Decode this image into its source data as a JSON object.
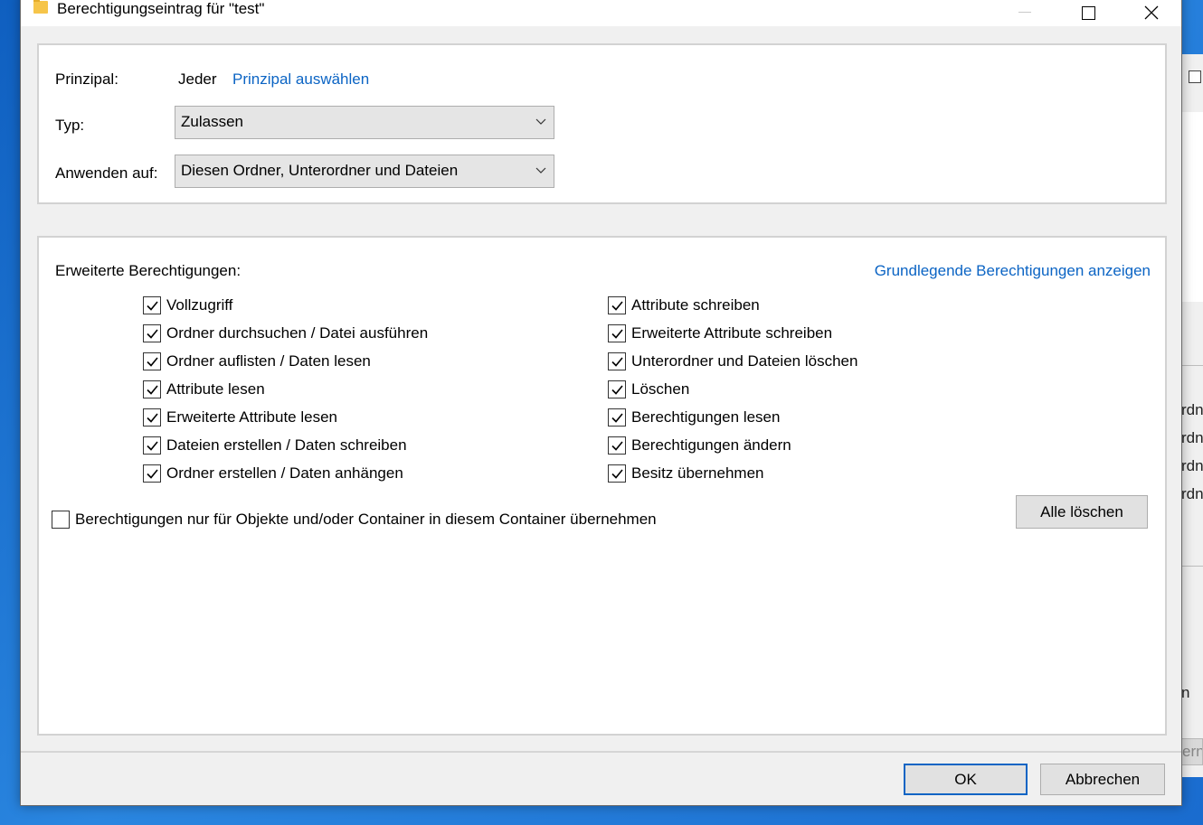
{
  "window": {
    "title": "Berechtigungseintrag für \"test\"",
    "accent_color": "#0b64c4"
  },
  "principal": {
    "label": "Prinzipal:",
    "value": "Jeder",
    "select_link": "Prinzipal auswählen"
  },
  "type": {
    "label": "Typ:",
    "selected": "Zulassen"
  },
  "apply_to": {
    "label": "Anwenden auf:",
    "selected": "Diesen Ordner, Unterordner und Dateien"
  },
  "advanced": {
    "heading": "Erweiterte Berechtigungen:",
    "basic_link": "Grundlegende Berechtigungen anzeigen",
    "left_column": [
      {
        "label": "Vollzugriff",
        "checked": true
      },
      {
        "label": "Ordner durchsuchen / Datei ausführen",
        "checked": true
      },
      {
        "label": "Ordner auflisten / Daten lesen",
        "checked": true
      },
      {
        "label": "Attribute lesen",
        "checked": true
      },
      {
        "label": "Erweiterte Attribute lesen",
        "checked": true
      },
      {
        "label": "Dateien erstellen / Daten schreiben",
        "checked": true
      },
      {
        "label": "Ordner erstellen / Daten anhängen",
        "checked": true
      }
    ],
    "right_column": [
      {
        "label": "Attribute schreiben",
        "checked": true
      },
      {
        "label": "Erweiterte Attribute schreiben",
        "checked": true
      },
      {
        "label": "Unterordner und Dateien löschen",
        "checked": true
      },
      {
        "label": "Löschen",
        "checked": true
      },
      {
        "label": "Berechtigungen lesen",
        "checked": true
      },
      {
        "label": "Berechtigungen ändern",
        "checked": true
      },
      {
        "label": "Besitz übernehmen",
        "checked": true
      }
    ],
    "inherit_only": {
      "label": "Berechtigungen nur für Objekte und/oder Container in diesem Container übernehmen",
      "checked": false
    },
    "clear_all_button": "Alle löschen"
  },
  "footer": {
    "ok_button": "OK",
    "cancel_button": "Abbrechen"
  },
  "background_window": {
    "rows": [
      "rdn",
      "rdn",
      "rdn",
      "rdn",
      "n"
    ],
    "button_fragment": "ern"
  }
}
